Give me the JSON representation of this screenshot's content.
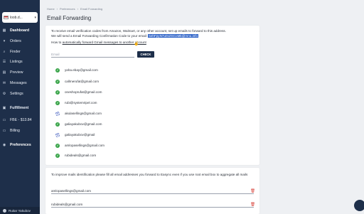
{
  "sidebar": {
    "store_label": "loob.d...",
    "nav": [
      {
        "label": "Dashboard",
        "icon": "dashboard-icon",
        "glyph": "▦"
      },
      {
        "label": "Orders",
        "icon": "cart-icon",
        "glyph": "🛒"
      },
      {
        "label": "Finder",
        "icon": "search-icon",
        "glyph": "⌕"
      },
      {
        "label": "Listings",
        "icon": "list-icon",
        "glyph": "☰"
      },
      {
        "label": "Preview",
        "icon": "preview-icon",
        "glyph": "▤"
      },
      {
        "label": "Messages",
        "icon": "mail-icon",
        "glyph": "✉"
      },
      {
        "label": "Settings",
        "icon": "gear-icon",
        "glyph": "⚙"
      },
      {
        "label": "Fulfillment",
        "icon": "box-icon",
        "glyph": "▣"
      },
      {
        "label": "FBE - $13.84",
        "icon": "wallet-icon",
        "glyph": "▭"
      },
      {
        "label": "Billing",
        "icon": "card-icon",
        "glyph": "▭"
      },
      {
        "label": "Preferences",
        "icon": "preferences-icon",
        "glyph": "◉"
      }
    ],
    "user_name": "Ruitar Yakubov"
  },
  "breadcrumb": [
    "Home",
    "›",
    "Preferences",
    "›",
    "Email Forwarding"
  ],
  "page_title": "Email Forwarding",
  "forwarding": {
    "intro_line1": "To receive email verification codes from Amazon, Walmart, or any other account, set up emails to forward to this address.",
    "intro_line2_prefix": "We will send a Email Forwarding Confirmation Code to your email:",
    "forwarding_address": "5ehFpyN7u0vZSCoMk@mnu.info",
    "intro_line3_prefix": "How to",
    "howto_link": "automatically forward Gmail messages to another account",
    "email_placeholder": "Email",
    "check_label": "CHECK",
    "emails": [
      {
        "address": "yaha.ebay@gmail.com",
        "status": "verified"
      },
      {
        "address": "callmerufat@gmail.com",
        "status": "verified"
      },
      {
        "address": "oneshoprufat@gmail.com",
        "status": "verified"
      },
      {
        "address": "rubi@systemripel.com",
        "status": "verified"
      },
      {
        "address": "akulasellings@gmail.com",
        "status": "pending"
      },
      {
        "address": "galiayakubov@gmail.com",
        "status": "verified"
      },
      {
        "address": "galiayakubov@gmail",
        "status": "pending"
      },
      {
        "address": "amlopasellings@gmail.com",
        "status": "verified"
      },
      {
        "address": "rubideals@gmail.com",
        "status": "verified"
      }
    ]
  },
  "aggregation": {
    "notice": "To improve mails identification please fill all email addresses you forward to Easync even if you use root email box to aggregate all mails",
    "rows": [
      "amlopasellings@gmail.com",
      "rubideals@gmail.com"
    ]
  },
  "colors": {
    "sidebar": "#1e2f4a",
    "verified": "#3aa54a",
    "pending": "#5c74c8",
    "delete": "#d8423a",
    "highlight": "#2f64c8"
  }
}
